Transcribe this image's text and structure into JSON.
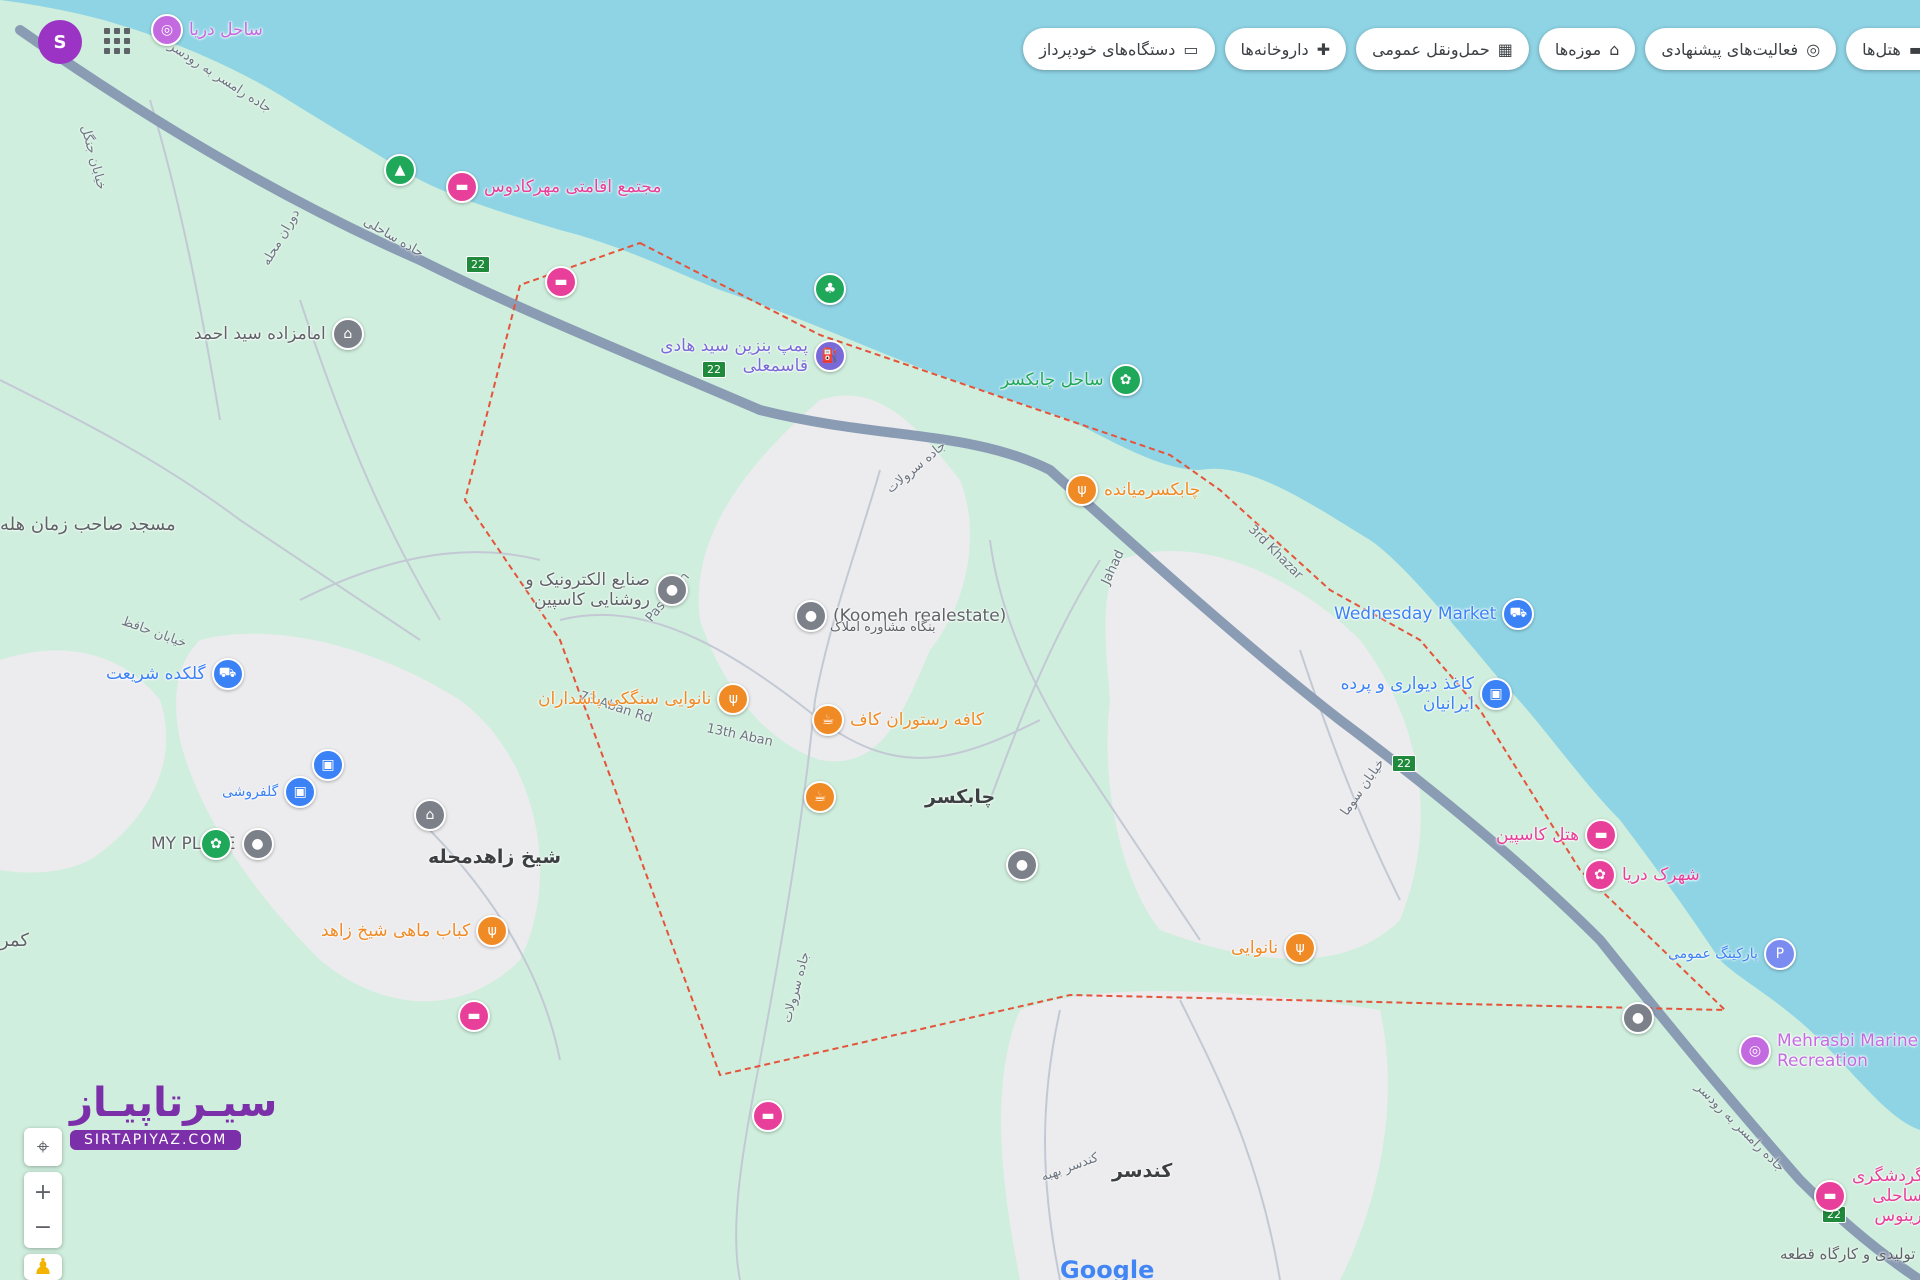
{
  "colors": {
    "sea": "#8fd4e5",
    "land": "#cfeedd",
    "park": "#c4ead2",
    "urban": "#ececee",
    "highway": "#8a9bb4",
    "boundary": "#e5533a",
    "food": "#f08a24",
    "hotel": "#e8409a",
    "shop": "#3b82f6",
    "civic": "#7b8089",
    "nature": "#1fa85a",
    "fuel": "#7a6ad8"
  },
  "user": {
    "avatar_letter": "S",
    "apps_icon": "apps-grid-icon"
  },
  "chips": [
    {
      "label": "هتل‌ها",
      "icon": "hotel-icon"
    },
    {
      "label": "فعالیت‌های پیشنهادی",
      "icon": "camera-icon"
    },
    {
      "label": "موزه‌ها",
      "icon": "museum-icon"
    },
    {
      "label": "حمل‌ونقل عمومی",
      "icon": "transit-icon"
    },
    {
      "label": "داروخانه‌ها",
      "icon": "pharmacy-icon"
    },
    {
      "label": "دستگاه‌های خودپرداز",
      "icon": "atm-icon"
    }
  ],
  "pois": [
    {
      "label": "ساحل دریا",
      "kind": "hotel",
      "icon": "camera-icon"
    },
    {
      "label": "مجتمع اقامتی مهرکادوس",
      "kind": "hotel",
      "icon": "bed-icon"
    },
    {
      "label": "",
      "kind": "nature",
      "icon": "tent-icon"
    },
    {
      "label": "",
      "kind": "hotel",
      "icon": "bed-icon"
    },
    {
      "label": "",
      "kind": "nature",
      "icon": "tree-icon"
    },
    {
      "label": "امامزاده سید احمد",
      "kind": "civic",
      "icon": "shrine-icon"
    },
    {
      "label": "پمپ بنزین سید هادی قاسمعلی",
      "kind": "fuel",
      "icon": "fuel-icon"
    },
    {
      "label": "ساحل چابکسر",
      "kind": "nature",
      "icon": "beach-icon"
    },
    {
      "label": "چابکسرمیانده",
      "kind": "food",
      "icon": "restaurant-icon"
    },
    {
      "label": "صنایع الکترونیک و روشنایی کاسپین",
      "kind": "civic",
      "icon": "pin-icon"
    },
    {
      "label": "(Koomeh realestate)",
      "kind": "civic",
      "icon": "pin-icon"
    },
    {
      "label": "بنگاه مشاوره املاک",
      "kind": "civic",
      "icon": ""
    },
    {
      "label": "Wednesday Market",
      "kind": "shop",
      "icon": "cart-icon"
    },
    {
      "label": "کاغذ دیواری و پرده ایرانیان",
      "kind": "shop",
      "icon": "shop-icon"
    },
    {
      "label": "گلکده شریعت",
      "kind": "shop",
      "icon": "cart-icon"
    },
    {
      "label": "نانوایی سنگکی پاسداران",
      "kind": "food",
      "icon": "restaurant-icon"
    },
    {
      "label": "کافه رستوران کاف",
      "kind": "food",
      "icon": "cafe-icon"
    },
    {
      "label": "",
      "kind": "food",
      "icon": "cafe-icon"
    },
    {
      "label": "",
      "kind": "shop",
      "icon": "shop-icon"
    },
    {
      "label": "گلفروشی",
      "kind": "shop",
      "icon": "shop-icon"
    },
    {
      "label": "MY PLACE",
      "kind": "civic",
      "icon": "pin-icon"
    },
    {
      "label": "",
      "kind": "nature",
      "icon": "flower-icon"
    },
    {
      "label": "",
      "kind": "civic",
      "icon": "shrine-icon"
    },
    {
      "label": "",
      "kind": "civic",
      "icon": "pin-icon"
    },
    {
      "label": "هتل کاسپین",
      "kind": "hotel",
      "icon": "bed-icon"
    },
    {
      "label": "شهرک دریا",
      "kind": "hotel",
      "icon": "beach-icon"
    },
    {
      "label": "پارکینگ عمومی",
      "kind": "shop",
      "icon": "parking-icon"
    },
    {
      "label": "",
      "kind": "civic",
      "icon": "pin-icon"
    },
    {
      "label": "Mehrasbi Marine Recreation",
      "kind": "hotel",
      "icon": "camera-icon"
    },
    {
      "label": "نانوایی",
      "kind": "food",
      "icon": "restaurant-icon"
    },
    {
      "label": "کباب ماهی شیخ زاهد",
      "kind": "food",
      "icon": "restaurant-icon"
    },
    {
      "label": "",
      "kind": "hotel",
      "icon": "bed-icon"
    },
    {
      "label": "",
      "kind": "hotel",
      "icon": "bed-icon"
    },
    {
      "label": "گردشگری ساحلی رینوس",
      "kind": "hotel",
      "icon": "bed-icon"
    }
  ],
  "places": [
    {
      "label": "چابکسر"
    },
    {
      "label": "شیخ زاهدمحله"
    },
    {
      "label": "کندسر"
    },
    {
      "label": "مسجد صاحب زمان هله"
    },
    {
      "label": "کمر"
    },
    {
      "label": "مجتمع تولیدی و کارگاه قطعه"
    }
  ],
  "roads": [
    {
      "label": "جاده رامسر به رودسر"
    },
    {
      "label": "جاده ساحلی"
    },
    {
      "label": "جاده سرولات"
    },
    {
      "label": "Pasdaran"
    },
    {
      "label": "73 Aban Rd"
    },
    {
      "label": "13th Aban"
    },
    {
      "label": "Jahad"
    },
    {
      "label": "3rd Khazar"
    },
    {
      "label": "خیابان سوما"
    },
    {
      "label": "جاده سرولات"
    },
    {
      "label": "خیابان حافظ"
    },
    {
      "label": "جاده رامسر به رودسر"
    },
    {
      "label": "دوران محله"
    },
    {
      "label": "خیابان جنگل"
    },
    {
      "label": "کندسر بهبه"
    }
  ],
  "highway_shield": "22",
  "controls": {
    "locate_icon": "locate-icon",
    "zoom_in": "+",
    "zoom_out": "−",
    "pegman_icon": "pegman-icon"
  },
  "watermark": {
    "title": "سیـرتاپیـاز",
    "url": "SIRTAPIYAZ.COM"
  },
  "google_logo": "Google"
}
